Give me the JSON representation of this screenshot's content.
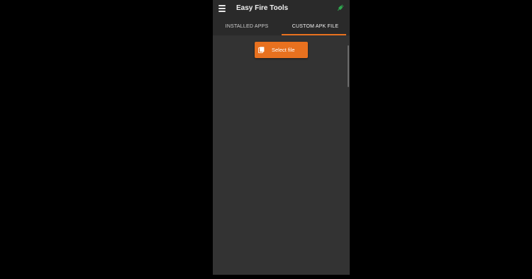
{
  "colors": {
    "accent": "#e8711f",
    "appbar": "#2a2a2a",
    "content": "#333333",
    "plug": "#2fa84f",
    "backdrop": "#000000"
  },
  "appbar": {
    "title": "Easy Fire Tools",
    "menu_icon": "hamburger-menu-icon",
    "status_icon": "plug-connected-icon"
  },
  "tabs": [
    {
      "label": "INSTALLED APPS",
      "selected": false
    },
    {
      "label": "CUSTOM APK FILE",
      "selected": true
    }
  ],
  "main": {
    "select_button": {
      "label": "Select file",
      "icon": "file-copy-icon"
    }
  }
}
